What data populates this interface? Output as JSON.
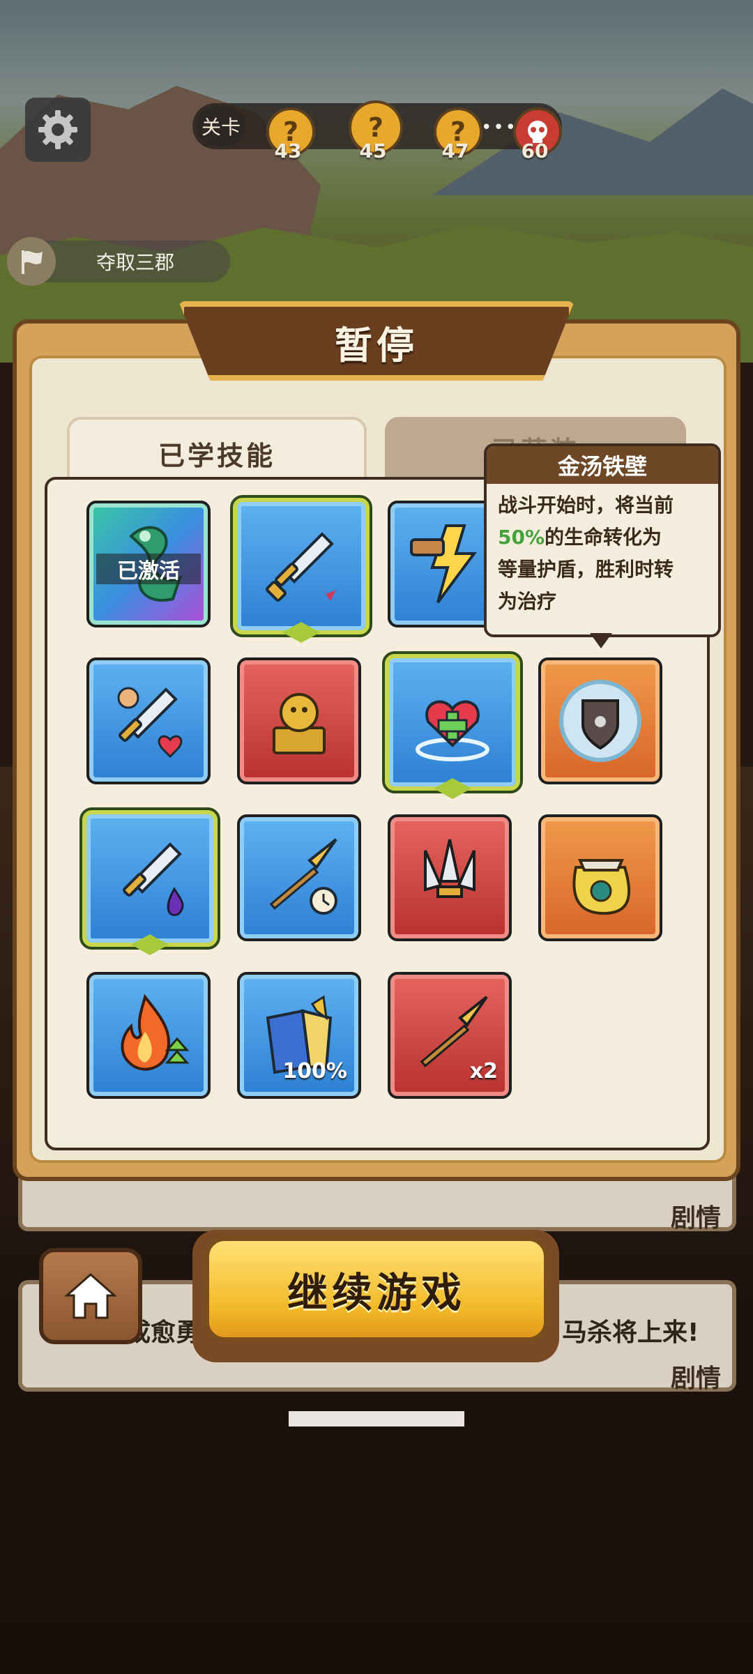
{
  "hud": {
    "level_label": "关卡",
    "stages": [
      {
        "number": "43",
        "icon": "question-mark"
      },
      {
        "number": "45",
        "icon": "question-mark"
      },
      {
        "number": "47",
        "icon": "question-mark"
      },
      {
        "number": "60",
        "icon": "boss-skull"
      }
    ],
    "stage_glyph": "?",
    "dots": "•••",
    "quest": "夺取三郡"
  },
  "pause_panel": {
    "title": "暂停",
    "tabs": [
      "已学技能",
      "已获装备"
    ],
    "tab_other_visible": "已获装"
  },
  "skills": [
    {
      "icon": "jade-dragon-icon",
      "color": "rainbow",
      "label": "已激活"
    },
    {
      "icon": "sword-icon",
      "color": "blue",
      "selected": true
    },
    {
      "icon": "lightning-hammer-icon",
      "color": "blue"
    },
    {
      "icon": "sword-heart-icon",
      "color": "blue"
    },
    {
      "icon": "golden-lion-seal-icon",
      "color": "red"
    },
    {
      "icon": "heart-heal-icon",
      "color": "blue",
      "selected": true
    },
    {
      "icon": "shield-bubble-icon",
      "color": "orange"
    },
    {
      "icon": "sword-poison-icon",
      "color": "blue",
      "selected": true
    },
    {
      "icon": "spear-clock-icon",
      "color": "blue"
    },
    {
      "icon": "triple-blades-icon",
      "color": "red"
    },
    {
      "icon": "loot-bag-icon",
      "color": "orange"
    },
    {
      "icon": "fire-up-icon",
      "color": "blue"
    },
    {
      "icon": "book-shield-icon",
      "color": "blue",
      "small_text": "100%"
    },
    {
      "icon": "spear-icon",
      "color": "red",
      "small_text": "x2"
    }
  ],
  "tooltip": {
    "title": "金汤铁壁",
    "line1": "战斗开始时，将当前",
    "highlight": "50%",
    "line2": "的生命转化为",
    "line3": "等量护盾，胜利时转",
    "line4": "为治疗"
  },
  "buttons": {
    "continue": "继续游戏"
  },
  "story": {
    "tag": "剧情",
    "text_left": "成愈勇",
    "text_right": "马杀将上来!"
  },
  "colors": {
    "panel_gold": "#d4a25b",
    "title_brown": "#6a3f20",
    "highlight_green": "#45a13a"
  }
}
